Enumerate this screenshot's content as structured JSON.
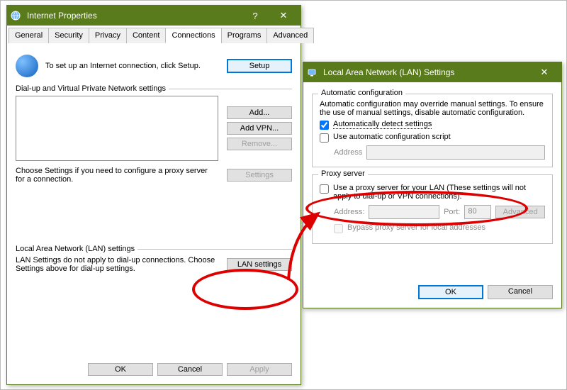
{
  "win1": {
    "title": "Internet Properties",
    "tabs": [
      "General",
      "Security",
      "Privacy",
      "Content",
      "Connections",
      "Programs",
      "Advanced"
    ],
    "activeTab": "Connections",
    "setupText": "To set up an Internet connection, click Setup.",
    "setupBtn": "Setup",
    "dialupHeader": "Dial-up and Virtual Private Network settings",
    "addBtn": "Add...",
    "addVpnBtn": "Add VPN...",
    "removeBtn": "Remove...",
    "settingsBtn": "Settings",
    "proxyNote": "Choose Settings if you need to configure a proxy server for a connection.",
    "lanHeader": "Local Area Network (LAN) settings",
    "lanNote": "LAN Settings do not apply to dial-up connections. Choose Settings above for dial-up settings.",
    "lanBtn": "LAN settings",
    "ok": "OK",
    "cancel": "Cancel",
    "apply": "Apply"
  },
  "win2": {
    "title": "Local Area Network (LAN) Settings",
    "autoLegend": "Automatic configuration",
    "autoNote": "Automatic configuration may override manual settings.  To ensure the use of manual settings, disable automatic configuration.",
    "autoDetect": "Automatically detect settings",
    "autoScript": "Use automatic configuration script",
    "addressLbl": "Address",
    "proxyLegend": "Proxy server",
    "useProxy": "Use a proxy server for your LAN (These settings will not apply to dial-up or VPN connections).",
    "addressLbl2": "Address:",
    "portLbl": "Port:",
    "portVal": "80",
    "advanced": "Advanced",
    "bypass": "Bypass proxy server for local addresses",
    "ok": "OK",
    "cancel": "Cancel"
  }
}
